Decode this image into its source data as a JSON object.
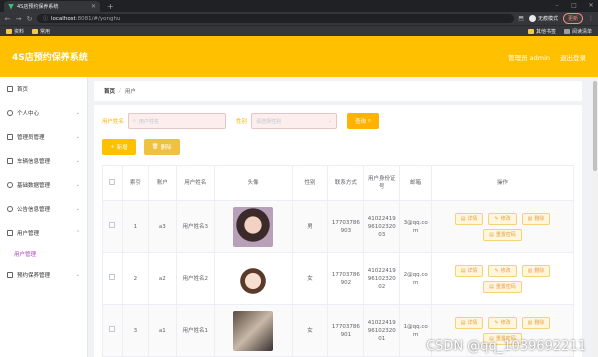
{
  "browser": {
    "tab_title": "4S店预约保养系统",
    "url_host": "localhost",
    "url_path": ":8081/#/yonghu",
    "incognito_label": "无痕模式",
    "update_label": "更新",
    "bookmarks": [
      "资料",
      "常用"
    ],
    "bookmarks_right": [
      "其他书签",
      "阅读清单"
    ]
  },
  "header": {
    "title": "4S店预约保养系统",
    "user": "管理员 admin",
    "logout": "退出登录"
  },
  "sidebar": {
    "items": [
      {
        "label": "首页",
        "icon": "home-icon",
        "expandable": false
      },
      {
        "label": "个人中心",
        "icon": "user-icon",
        "expandable": true
      },
      {
        "label": "管理员管理",
        "icon": "admin-icon",
        "expandable": true
      },
      {
        "label": "车辆信息管理",
        "icon": "car-icon",
        "expandable": true
      },
      {
        "label": "基础数据管理",
        "icon": "data-icon",
        "expandable": true
      },
      {
        "label": "公告信息管理",
        "icon": "notice-icon",
        "expandable": true
      },
      {
        "label": "用户管理",
        "icon": "users-icon",
        "expandable": true
      },
      {
        "label": "预约保养管理",
        "icon": "calendar-icon",
        "expandable": true
      }
    ],
    "active_sub": "用户管理"
  },
  "breadcrumb": {
    "home": "首页",
    "sep": "/",
    "current": "用户"
  },
  "search": {
    "name_label": "用户姓名",
    "name_placeholder": "用户姓名",
    "gender_label": "性别",
    "gender_placeholder": "请选择性别",
    "query_label": "查询"
  },
  "actions": {
    "add": "新增",
    "delete": "删除"
  },
  "table": {
    "headers": [
      "",
      "索引",
      "账户",
      "用户姓名",
      "头像",
      "性别",
      "联系方式",
      "用户身份证号",
      "邮箱",
      "操作"
    ],
    "rows": [
      {
        "index": "1",
        "account": "a3",
        "name": "用户姓名3",
        "gender": "男",
        "phone": "17703786903",
        "idcard": "410224199610232003",
        "email": "3@qq.com"
      },
      {
        "index": "2",
        "account": "a2",
        "name": "用户姓名2",
        "gender": "女",
        "phone": "17703786902",
        "idcard": "410224199610232002",
        "email": "2@qq.com"
      },
      {
        "index": "3",
        "account": "a1",
        "name": "用户姓名1",
        "gender": "女",
        "phone": "17703786901",
        "idcard": "410224199610232001",
        "email": "1@qq.com"
      }
    ],
    "ops": {
      "detail": "详情",
      "edit": "修改",
      "delete": "删除",
      "reset": "重置密码"
    }
  },
  "watermark": "CSDN @qq_1039692211"
}
